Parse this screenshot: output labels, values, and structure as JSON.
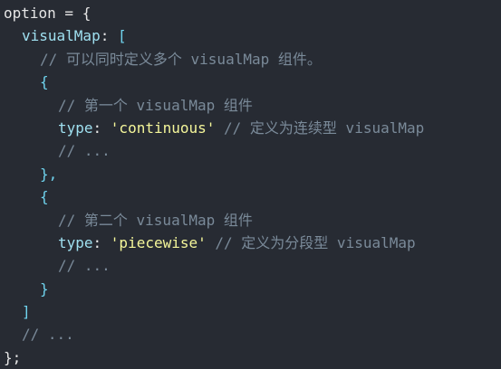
{
  "code": {
    "lines": [
      {
        "indent": 0,
        "tokens": [
          {
            "t": "option = {",
            "c": "plain"
          }
        ]
      },
      {
        "indent": 1,
        "tokens": [
          {
            "t": "visualMap",
            "c": "key"
          },
          {
            "t": ": ",
            "c": "plain"
          },
          {
            "t": "[",
            "c": "bracket"
          }
        ]
      },
      {
        "indent": 2,
        "tokens": [
          {
            "t": "// 可以同时定义多个 visualMap 组件。",
            "c": "comment"
          }
        ]
      },
      {
        "indent": 2,
        "tokens": [
          {
            "t": "{",
            "c": "bracket"
          }
        ]
      },
      {
        "indent": 3,
        "tokens": [
          {
            "t": "// 第一个 visualMap 组件",
            "c": "comment"
          }
        ]
      },
      {
        "indent": 3,
        "tokens": [
          {
            "t": "type",
            "c": "key"
          },
          {
            "t": ": ",
            "c": "plain"
          },
          {
            "t": "'continuous'",
            "c": "string"
          },
          {
            "t": " // 定义为连续型 visualMap",
            "c": "comment"
          }
        ]
      },
      {
        "indent": 3,
        "tokens": [
          {
            "t": "// ...",
            "c": "comment"
          }
        ]
      },
      {
        "indent": 2,
        "tokens": [
          {
            "t": "},",
            "c": "bracket"
          }
        ]
      },
      {
        "indent": 2,
        "tokens": [
          {
            "t": "{",
            "c": "bracket"
          }
        ]
      },
      {
        "indent": 3,
        "tokens": [
          {
            "t": "// 第二个 visualMap 组件",
            "c": "comment"
          }
        ]
      },
      {
        "indent": 3,
        "tokens": [
          {
            "t": "type",
            "c": "key"
          },
          {
            "t": ": ",
            "c": "plain"
          },
          {
            "t": "'piecewise'",
            "c": "string"
          },
          {
            "t": " // 定义为分段型 visualMap",
            "c": "comment"
          }
        ]
      },
      {
        "indent": 3,
        "tokens": [
          {
            "t": "// ...",
            "c": "comment"
          }
        ]
      },
      {
        "indent": 2,
        "tokens": [
          {
            "t": "}",
            "c": "bracket"
          }
        ]
      },
      {
        "indent": 1,
        "tokens": [
          {
            "t": "]",
            "c": "bracket"
          }
        ]
      },
      {
        "indent": 1,
        "tokens": [
          {
            "t": "// ...",
            "c": "comment"
          }
        ]
      },
      {
        "indent": 0,
        "tokens": [
          {
            "t": "};",
            "c": "plain"
          }
        ]
      }
    ]
  },
  "colors": {
    "background": "#272b33",
    "plain": "#e6e6e6",
    "key": "#9fe0f0",
    "bracket": "#6fd3ee",
    "comment": "#7a8a99",
    "string": "#f4f69a"
  }
}
